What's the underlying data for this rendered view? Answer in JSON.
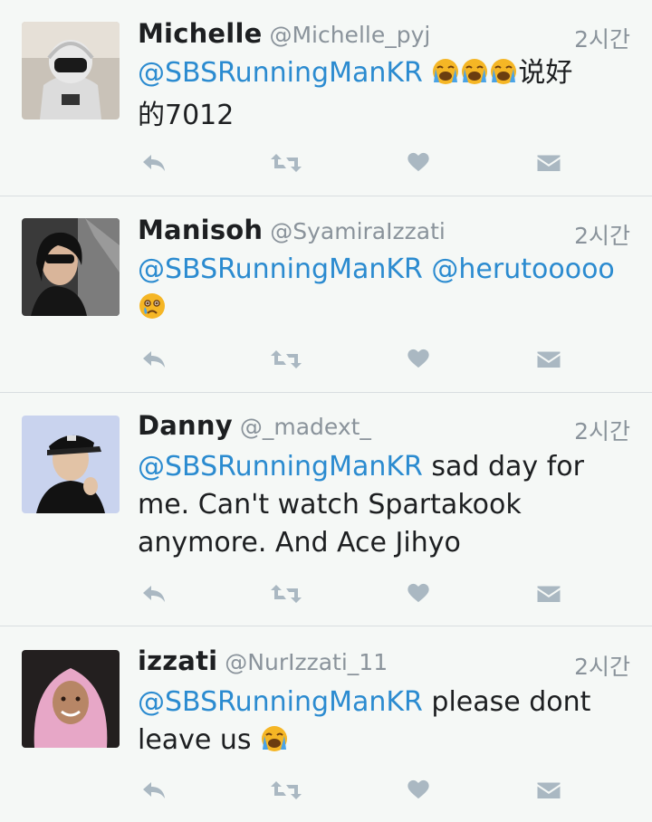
{
  "tweets": [
    {
      "name": "Michelle",
      "handle": "@Michelle_pyj",
      "time": "2시간",
      "mention": "@SBSRunningManKR",
      "text_after_emoji": "说好",
      "text_line2": "的7012",
      "emojis": [
        "loudly-crying-face",
        "loudly-crying-face",
        "loudly-crying-face"
      ]
    },
    {
      "name": "Manisoh",
      "handle": "@SyamiraIzzati",
      "time": "2시간",
      "mention": "@SBSRunningManKR",
      "mention2": "@herutooooo",
      "emojis": [
        "crying-face"
      ]
    },
    {
      "name": "Danny",
      "handle": "@_madext_",
      "time": "2시간",
      "mention": "@SBSRunningManKR",
      "text": " sad day for me. Can't watch Spartakook anymore. And Ace Jihyo"
    },
    {
      "name": "izzati",
      "handle": "@NurIzzati_11",
      "time": "2시간",
      "mention": "@SBSRunningManKR",
      "text": " please dont leave us ",
      "emojis": [
        "loudly-crying-face"
      ]
    }
  ],
  "actions": [
    "reply-icon",
    "retweet-icon",
    "like-icon",
    "direct-message-icon"
  ],
  "colors": {
    "background": "#f5f8f6",
    "mention": "#2b8bd0",
    "icon": "#aab8c2",
    "secondary_text": "#8a939b"
  }
}
